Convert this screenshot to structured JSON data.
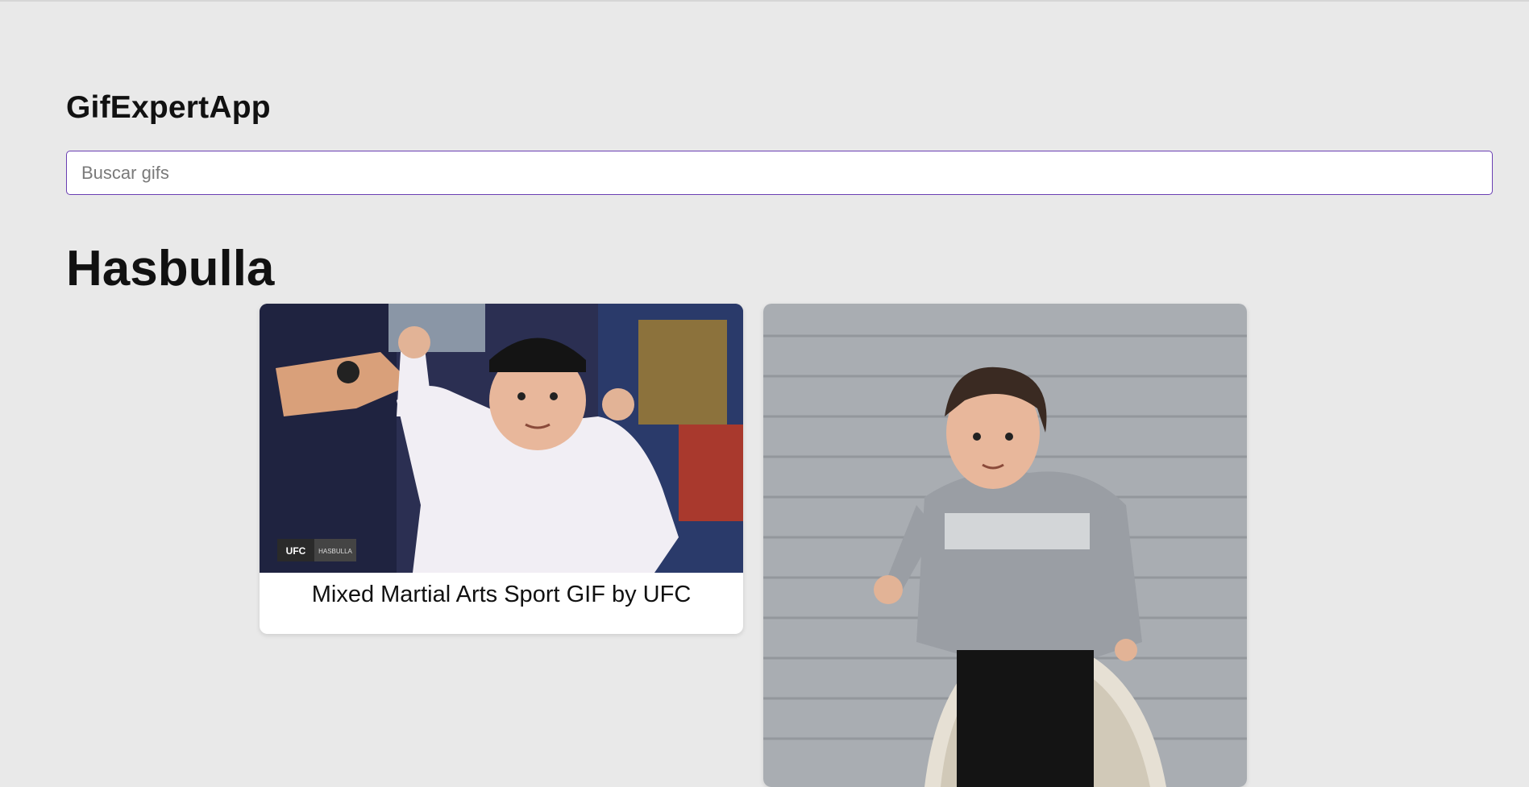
{
  "app": {
    "title": "GifExpertApp"
  },
  "search": {
    "placeholder": "Buscar gifs",
    "value": ""
  },
  "categories": [
    {
      "title": "Hasbulla",
      "gifs": [
        {
          "title": "Mixed Martial Arts Sport GIF by UFC",
          "overlay_badge": "UFC",
          "overlay_label": "HASBULLA"
        },
        {
          "title": ""
        }
      ]
    }
  ],
  "colors": {
    "background": "#e9e9e9",
    "input_border": "#6a3fb3",
    "card": "#ffffff"
  }
}
